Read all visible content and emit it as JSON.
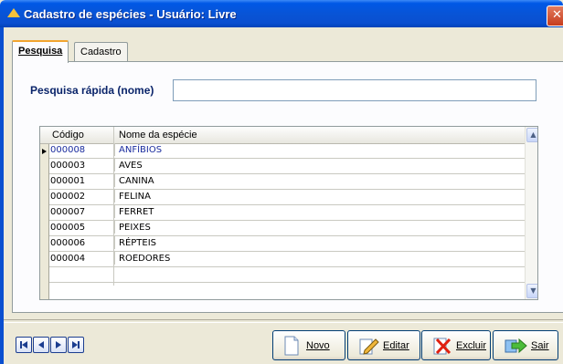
{
  "window": {
    "title": "Cadastro de espécies - Usuário: Livre",
    "close_glyph": "✕"
  },
  "tabs": [
    {
      "label": "Pesquisa",
      "active": true
    },
    {
      "label": "Cadastro",
      "active": false
    }
  ],
  "search": {
    "label": "Pesquisa rápida (nome)",
    "value": "",
    "placeholder": ""
  },
  "grid": {
    "headers": [
      "Código",
      "Nome da espécie"
    ],
    "rows": [
      {
        "code": "000008",
        "name": "ANFÍBIOS"
      },
      {
        "code": "000003",
        "name": "AVES"
      },
      {
        "code": "000001",
        "name": "CANINA"
      },
      {
        "code": "000002",
        "name": "FELINA"
      },
      {
        "code": "000007",
        "name": "FERRET"
      },
      {
        "code": "000005",
        "name": "PEIXES"
      },
      {
        "code": "000006",
        "name": "RÉPTEIS"
      },
      {
        "code": "000004",
        "name": "ROEDORES"
      }
    ],
    "selected_row": 0
  },
  "buttons": {
    "novo": "Novo",
    "editar": "Editar",
    "excluir": "Excluir",
    "sair": "Sair"
  },
  "icons": {
    "first": "first-record-icon",
    "prev": "previous-record-icon",
    "next": "next-record-icon",
    "last": "last-record-icon"
  },
  "colors": {
    "title_bar": "#0a4fd0",
    "selection_text": "#1a2c9e",
    "label_text": "#0a246a"
  }
}
